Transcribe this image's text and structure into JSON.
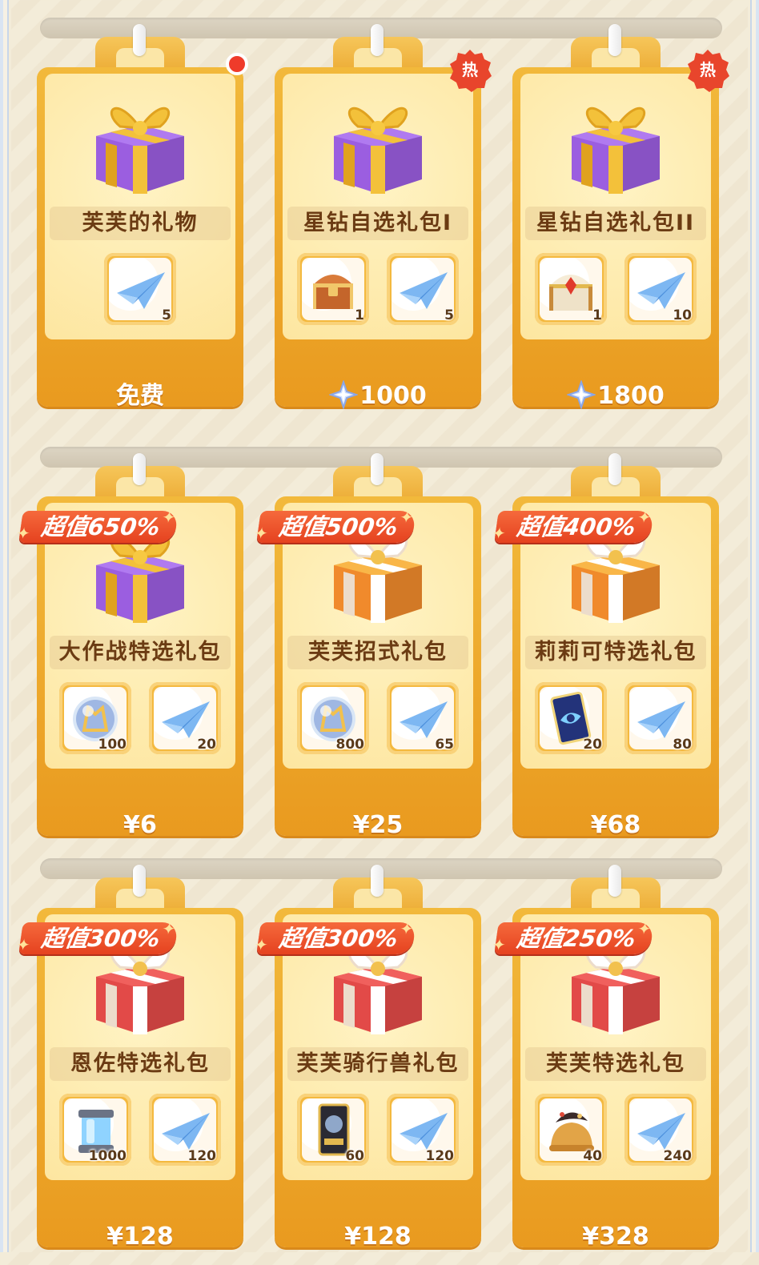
{
  "colors": {
    "card": "#f2b93b",
    "badge": "#e5421f",
    "name_text": "#6b3b13",
    "price_text": "#ffffff"
  },
  "cards": [
    {
      "name": "芙芙的礼物",
      "price": "免费",
      "currency": "",
      "gift": "purple",
      "marker": "dot",
      "badge": "",
      "items": [
        {
          "icon": "paper-plane-icon",
          "qty": "5"
        }
      ]
    },
    {
      "name": "星钻自选礼包I",
      "price": "1000",
      "currency": "star-diamond-icon",
      "gift": "purple",
      "marker": "hot",
      "hot": "热",
      "badge": "",
      "items": [
        {
          "icon": "treasure-chest-icon",
          "qty": "1"
        },
        {
          "icon": "paper-plane-icon",
          "qty": "5"
        }
      ]
    },
    {
      "name": "星钻自选礼包II",
      "price": "1800",
      "currency": "star-diamond-icon",
      "gift": "purple",
      "marker": "hot",
      "hot": "热",
      "badge": "",
      "items": [
        {
          "icon": "jeweled-chest-icon",
          "qty": "1"
        },
        {
          "icon": "paper-plane-icon",
          "qty": "10"
        }
      ]
    },
    {
      "name": "大作战特选礼包",
      "price": "¥6",
      "currency": "",
      "gift": "purple",
      "marker": "",
      "badge": "超值650%",
      "items": [
        {
          "icon": "crystal-orb-icon",
          "qty": "100"
        },
        {
          "icon": "paper-plane-icon",
          "qty": "20"
        }
      ]
    },
    {
      "name": "芙芙招式礼包",
      "price": "¥25",
      "currency": "",
      "gift": "orange",
      "marker": "",
      "badge": "超值500%",
      "items": [
        {
          "icon": "crystal-orb-icon",
          "qty": "800"
        },
        {
          "icon": "paper-plane-icon",
          "qty": "65"
        }
      ]
    },
    {
      "name": "莉莉可特选礼包",
      "price": "¥68",
      "currency": "",
      "gift": "orange",
      "marker": "",
      "badge": "超值400%",
      "items": [
        {
          "icon": "eye-card-icon",
          "qty": "20"
        },
        {
          "icon": "paper-plane-icon",
          "qty": "80"
        }
      ]
    },
    {
      "name": "恩佐特选礼包",
      "price": "¥128",
      "currency": "",
      "gift": "red",
      "marker": "",
      "badge": "超值300%",
      "items": [
        {
          "icon": "energy-canister-icon",
          "qty": "1000"
        },
        {
          "icon": "paper-plane-icon",
          "qty": "120"
        }
      ]
    },
    {
      "name": "芙芙骑行兽礼包",
      "price": "¥128",
      "currency": "",
      "gift": "red",
      "marker": "",
      "badge": "超值300%",
      "items": [
        {
          "icon": "mount-card-icon",
          "qty": "60"
        },
        {
          "icon": "paper-plane-icon",
          "qty": "120"
        }
      ]
    },
    {
      "name": "芙芙特选礼包",
      "price": "¥328",
      "currency": "",
      "gift": "red",
      "marker": "",
      "badge": "超值250%",
      "items": [
        {
          "icon": "bell-hat-icon",
          "qty": "40"
        },
        {
          "icon": "paper-plane-icon",
          "qty": "240"
        }
      ]
    }
  ]
}
